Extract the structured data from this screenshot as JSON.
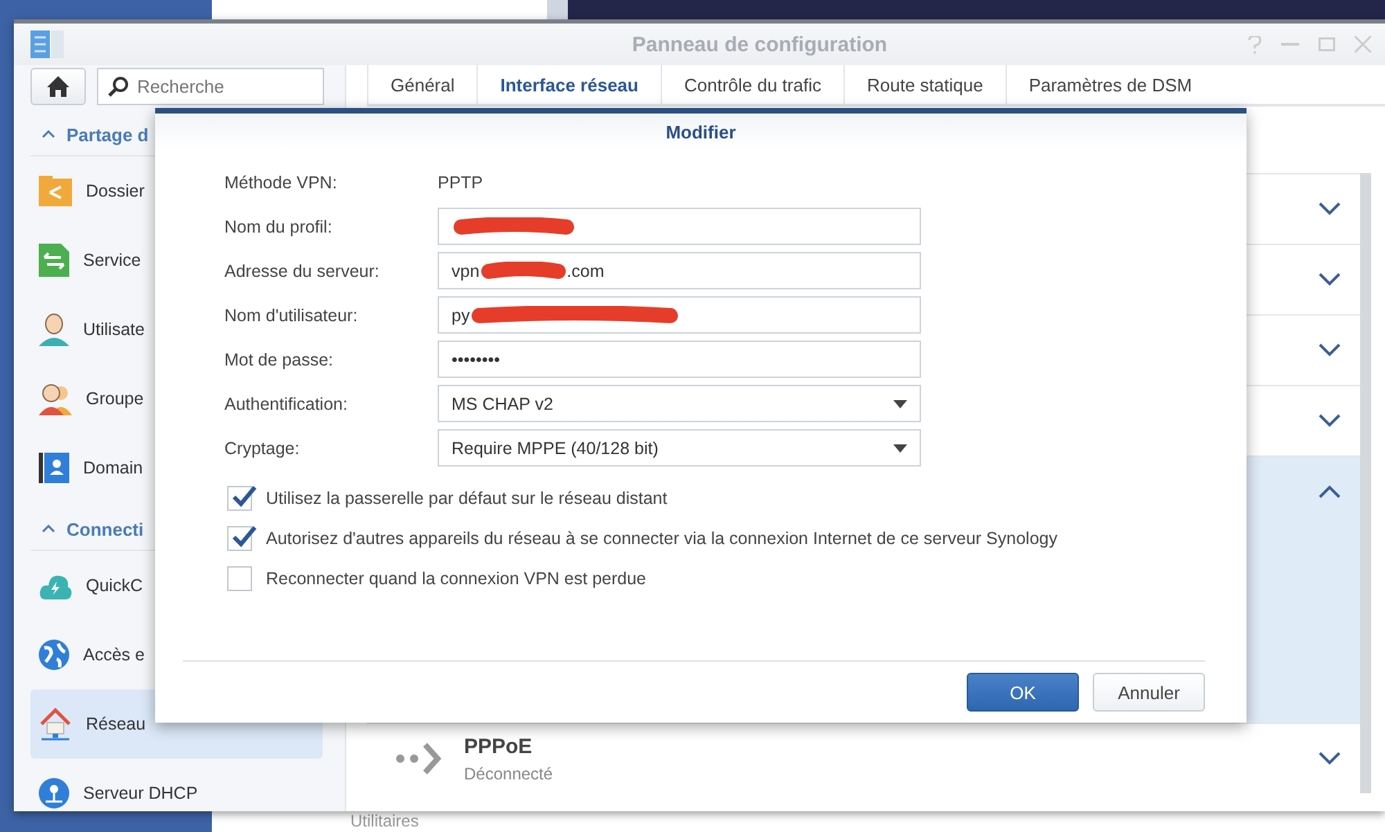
{
  "window": {
    "title": "Panneau de configuration"
  },
  "sidebar": {
    "search": {
      "placeholder": "Recherche"
    },
    "items": [
      {
        "kind": "header",
        "label": "Partage d",
        "expanded": true
      },
      {
        "kind": "item",
        "label": "Dossier",
        "selected": false
      },
      {
        "kind": "item",
        "label": "Service",
        "selected": false
      },
      {
        "kind": "item",
        "label": "Utilisate",
        "selected": false
      },
      {
        "kind": "item",
        "label": "Groupe",
        "selected": false
      },
      {
        "kind": "item",
        "label": "Domain",
        "selected": false
      },
      {
        "kind": "header",
        "label": "Connecti",
        "expanded": true
      },
      {
        "kind": "item",
        "label": "QuickC",
        "selected": false
      },
      {
        "kind": "item",
        "label": "Accès e",
        "selected": false
      },
      {
        "kind": "item",
        "label": "Réseau",
        "selected": true
      },
      {
        "kind": "item",
        "label": "Serveur DHCP",
        "selected": false
      }
    ]
  },
  "tabs": [
    {
      "label": "Général",
      "selected": false
    },
    {
      "label": "Interface réseau",
      "selected": true
    },
    {
      "label": "Contrôle du trafic",
      "selected": false
    },
    {
      "label": "Route statique",
      "selected": false
    },
    {
      "label": "Paramètres de DSM",
      "selected": false
    }
  ],
  "interfaces": [
    {
      "expanded": false
    },
    {
      "expanded": false
    },
    {
      "expanded": false
    },
    {
      "expanded": false
    },
    {
      "expanded": true
    },
    {
      "expanded": false,
      "title": "PPPoE",
      "status": "Déconnecté"
    }
  ],
  "dialog": {
    "title": "Modifier",
    "fields": [
      {
        "kind": "static",
        "label": "Méthode VPN:",
        "value": "PPTP"
      },
      {
        "kind": "text",
        "label": "Nom du profil:",
        "redacted": true
      },
      {
        "kind": "text",
        "label": "Adresse du serveur:",
        "value": "vpn",
        "value_end": ".com",
        "redacted": true
      },
      {
        "kind": "text",
        "label": "Nom d'utilisateur:",
        "value": "py",
        "redacted": true
      },
      {
        "kind": "password",
        "label": "Mot de passe:",
        "value": "••••••••"
      },
      {
        "kind": "select",
        "label": "Authentification:",
        "value": "MS CHAP v2"
      },
      {
        "kind": "select",
        "label": "Cryptage:",
        "value": "Require MPPE (40/128 bit)"
      }
    ],
    "checkboxes": [
      {
        "label": "Utilisez la passerelle par défaut sur le réseau distant",
        "checked": true
      },
      {
        "label": "Autorisez d'autres appareils du réseau à se connecter via la connexion Internet de ce serveur Synology",
        "checked": true
      },
      {
        "label": "Reconnecter quand la connexion VPN est perdue",
        "checked": false
      }
    ],
    "buttons": [
      {
        "kind": "primary",
        "label": "OK"
      },
      {
        "kind": "secondary",
        "label": "Annuler"
      }
    ]
  },
  "background": {
    "label": "Utilitaires"
  }
}
